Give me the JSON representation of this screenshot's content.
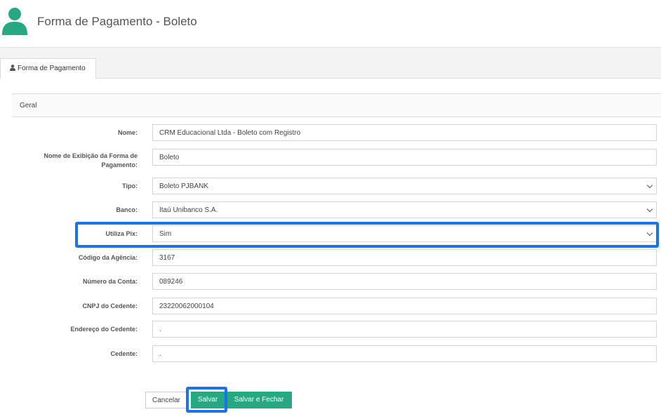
{
  "header": {
    "title": "Forma de Pagamento - Boleto",
    "icon": "user-avatar-icon",
    "accent": "#26a983"
  },
  "tabs": [
    {
      "label": "Forma de Pagamento",
      "icon": "user-icon"
    }
  ],
  "section": {
    "title": "Geral"
  },
  "form": {
    "nome": {
      "label": "Nome:",
      "value": "CRM Educacional Ltda - Boleto com Registro"
    },
    "nome_exibicao": {
      "label": "Nome de Exibição da Forma de Pagamento:",
      "value": "Boleto"
    },
    "tipo": {
      "label": "Tipo:",
      "value": "Boleto PJBANK"
    },
    "banco": {
      "label": "Banco:",
      "value": "Itaú Unibanco S.A."
    },
    "utiliza_pix": {
      "label": "Utiliza Pix:",
      "value": "Sim"
    },
    "agencia": {
      "label": "Código da Agência:",
      "value": "3167"
    },
    "conta": {
      "label": "Número da Conta:",
      "value": "089246"
    },
    "cnpj": {
      "label": "CNPJ do Cedente:",
      "value": "23220062000104"
    },
    "endereco": {
      "label": "Endereço do Cedente:",
      "value": "."
    },
    "cedente": {
      "label": "Cedente:",
      "value": "."
    }
  },
  "buttons": {
    "cancel": "Cancelar",
    "save": "Salvar",
    "save_close": "Salvar e Fechar"
  },
  "highlight_color": "#1a73e8"
}
